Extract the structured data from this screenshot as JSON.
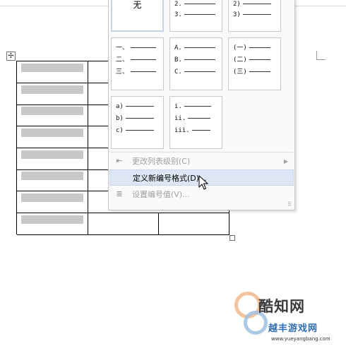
{
  "tiles": [
    {
      "type": "none",
      "label": "无"
    },
    {
      "type": "list",
      "markers": [
        "2.",
        "3."
      ]
    },
    {
      "type": "list",
      "markers": [
        "2)",
        "3)"
      ]
    },
    {
      "type": "list",
      "markers": [
        "一、",
        "二、",
        "三、"
      ]
    },
    {
      "type": "list",
      "markers": [
        "A.",
        "B.",
        "C."
      ]
    },
    {
      "type": "list",
      "markers": [
        "(一)",
        "(二)",
        "(三)"
      ]
    },
    {
      "type": "list",
      "markers": [
        "a)",
        "b)",
        "c)"
      ]
    },
    {
      "type": "list",
      "markers": [
        "i.",
        "ii.",
        "iii."
      ]
    }
  ],
  "menu": {
    "change_level": "更改列表级别(C)",
    "define_format": "定义新编号格式(D)...",
    "set_value": "设置编号值(V)..."
  },
  "watermark": {
    "brand": "酷知网",
    "brand2": "越丰游戏网",
    "url": "www.yueyangbang.com"
  }
}
